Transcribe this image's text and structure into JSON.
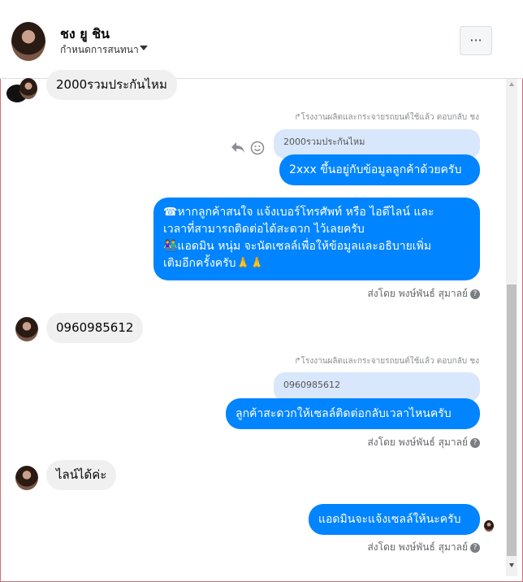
{
  "header": {
    "name": "ชง ยู ชิน",
    "subtitle": "กำหนดการสนทนา",
    "more_label": "···"
  },
  "messages": {
    "m1": "2000รวมประกันไหม",
    "reply1": "โรงงานผลิตและกระจายรถยนต์ใช้แล้ว ตอบกลับ ชง",
    "quote1": "2000รวมประกันไหม",
    "out1": "2xxx ขึ้นอยู่กับข้อมูลลูกค้าด้วยครับ",
    "out2_line1": "☎หากลูกค้าสนใจ แจ้งเบอร์โทรศัพท์ หรือ ไอดีไลน์ และ",
    "out2_line2": "เวลาที่สามารถติดต่อได้สะดวก ไว้เลยครับ",
    "out2_line3": "👫แอดมิน หนุ่ม จะนัดเซลล์เพื่อให้ข้อมูลและอธิบายเพิ่ม",
    "out2_line4": "เติมอีกครั้งครับ🙏🙏",
    "sentby1": "ส่งโดย พงษ์พันธ์ สุมาลย์",
    "m2": "0960985612",
    "reply2": "โรงงานผลิตและกระจายรถยนต์ใช้แล้ว ตอบกลับ ชง",
    "quote2": "0960985612",
    "out3": "ลูกค้าสะดวกให้เซลล์ติดต่อกลับเวลาไหนครับ",
    "sentby2": "ส่งโดย พงษ์พันธ์ สุมาลย์",
    "m3": "ไลน์ได้ค่ะ",
    "out4": "แอดมินจะแจ้งเซลล์ให้นะครับ",
    "sentby3": "ส่งโดย พงษ์พันธ์ สุมาลย์"
  },
  "icons": [
    "reply-icon",
    "emoji-icon",
    "help-icon",
    "more-icon",
    "dropdown-caret-icon"
  ],
  "colors": {
    "outgoing_bubble": "#0084ff",
    "incoming_bubble": "#f0f0f0",
    "quote_bubble": "#d8e7fb"
  }
}
